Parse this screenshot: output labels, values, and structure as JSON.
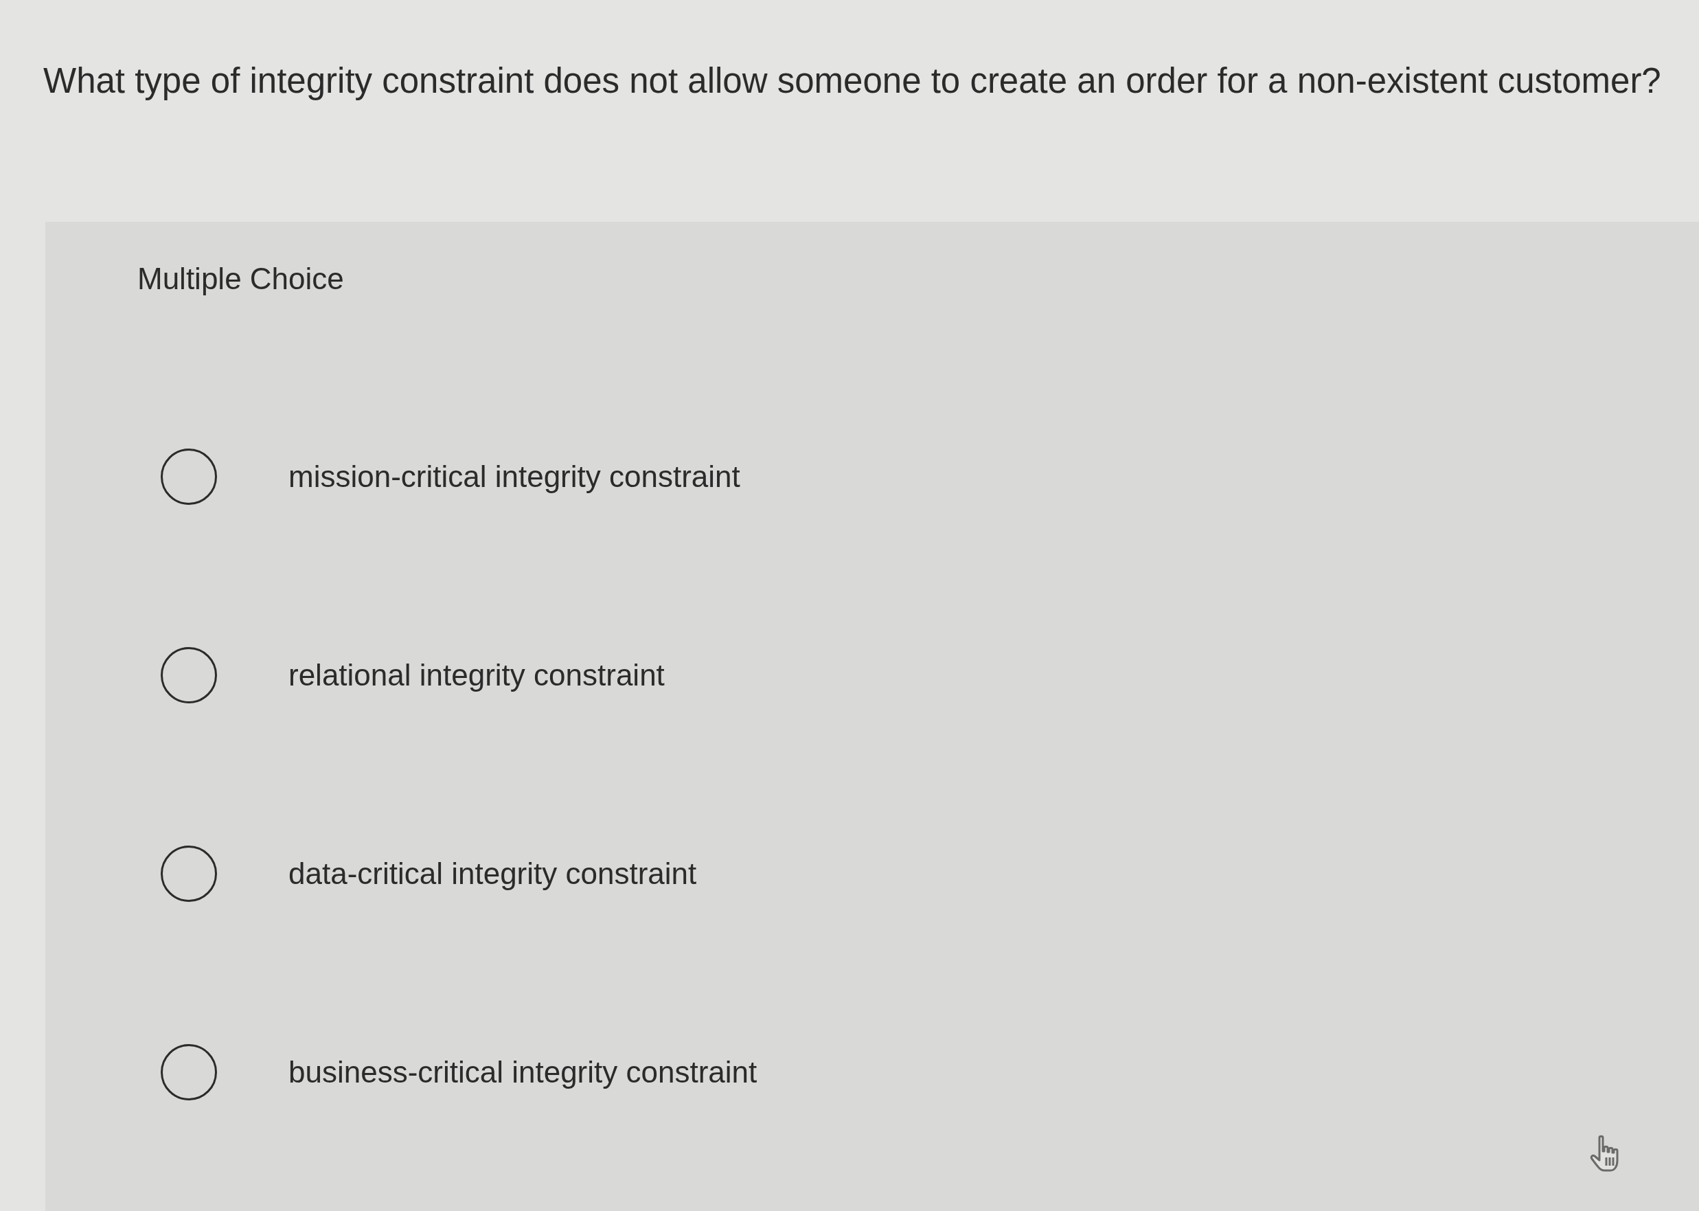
{
  "question": "What type of integrity constraint does not allow someone to create an order for a non-existent customer?",
  "answer_panel": {
    "heading": "Multiple Choice",
    "options": [
      {
        "label": "mission-critical integrity constraint",
        "selected": false
      },
      {
        "label": "relational integrity constraint",
        "selected": false
      },
      {
        "label": "data-critical integrity constraint",
        "selected": false
      },
      {
        "label": "business-critical integrity constraint",
        "selected": false
      }
    ]
  }
}
